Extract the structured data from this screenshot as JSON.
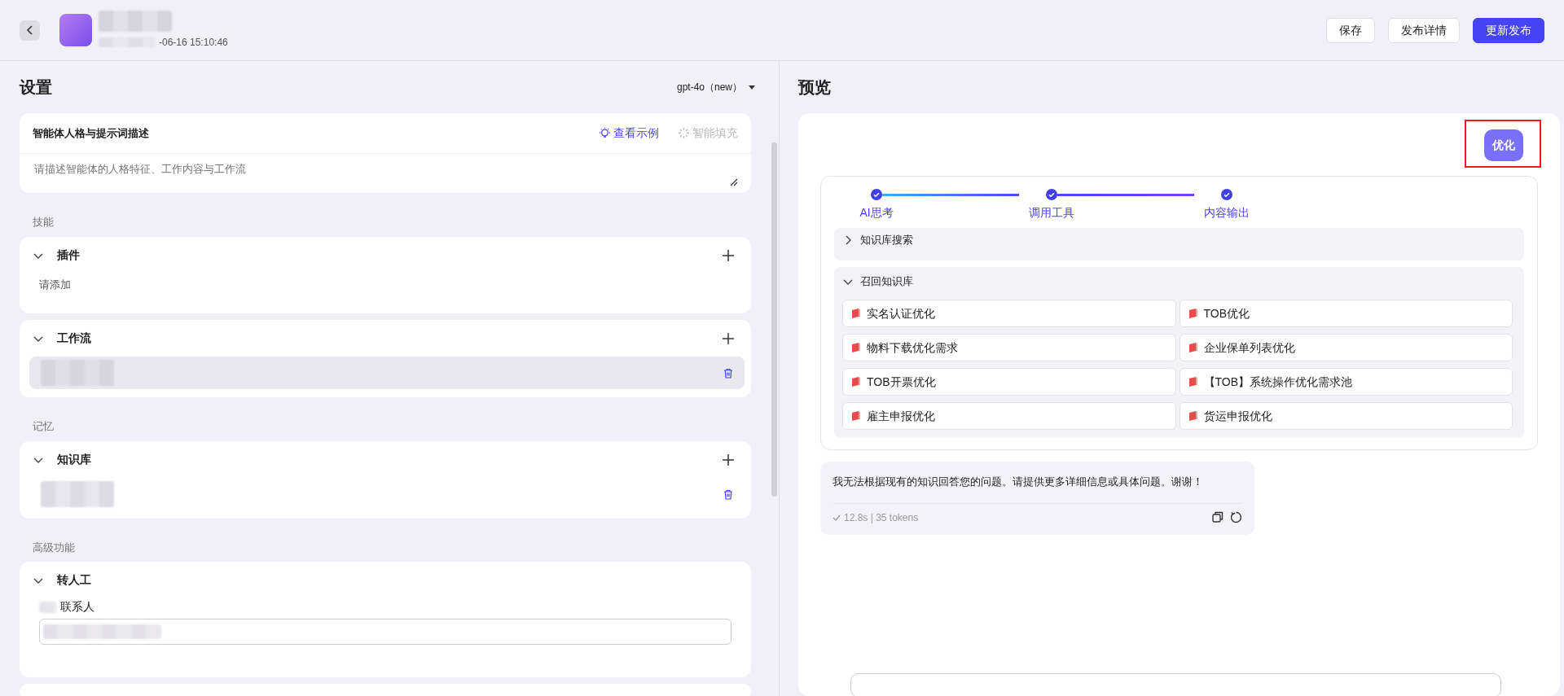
{
  "header": {
    "timestamp": "-06-16 15:10:46",
    "buttons": [
      {
        "label": "保存",
        "kind": "outline"
      },
      {
        "label": "发布详情",
        "kind": "outline"
      },
      {
        "label": "更新发布",
        "kind": "primary"
      }
    ]
  },
  "settings": {
    "title": "设置",
    "model": "gpt-4o（new）",
    "prompt_card": {
      "title": "智能体人格与提示词描述",
      "actions": [
        {
          "label": "查看示例",
          "disabled": false
        },
        {
          "label": "智能填充",
          "disabled": true
        }
      ],
      "placeholder": "请描述智能体的人格特征、工作内容与工作流"
    },
    "sections": [
      {
        "label": "技能",
        "cards": [
          {
            "title": "插件",
            "expanded": true,
            "addable": true,
            "content": [
              {
                "kind": "text",
                "text": "请添加"
              }
            ]
          },
          {
            "title": "工作流",
            "expanded": true,
            "addable": true,
            "content": [
              {
                "kind": "redacted",
                "selected": true
              }
            ]
          }
        ]
      },
      {
        "label": "记忆",
        "cards": [
          {
            "title": "知识库",
            "expanded": true,
            "addable": true,
            "content": [
              {
                "kind": "redacted",
                "selected": false
              }
            ]
          }
        ]
      },
      {
        "label": "高级功能",
        "cards": [
          {
            "title": "转人工",
            "expanded": true,
            "content": [
              {
                "kind": "field",
                "label": "联系人"
              }
            ]
          }
        ]
      }
    ]
  },
  "preview": {
    "title": "预览",
    "user_message": {
      "text": "优化",
      "highlighted": true
    },
    "steps": [
      {
        "label": "AI思考",
        "done": true
      },
      {
        "label": "调用工具",
        "done": true
      },
      {
        "label": "内容输出",
        "done": true
      }
    ],
    "process_rows": [
      {
        "title": "知识库搜索",
        "expanded": false
      },
      {
        "title": "召回知识库",
        "expanded": true,
        "documents": [
          "实名认证优化",
          "TOB优化",
          "物料下载优化需求",
          "企业保单列表优化",
          "TOB开票优化",
          "【TOB】系统操作优化需求池",
          "雇主申报优化",
          "货运申报优化"
        ]
      }
    ],
    "answer": {
      "text": "我无法根据现有的知识回答您的问题。请提供更多详细信息或具体问题。谢谢！",
      "done": true,
      "meta": "12.8s | 35 tokens"
    }
  }
}
